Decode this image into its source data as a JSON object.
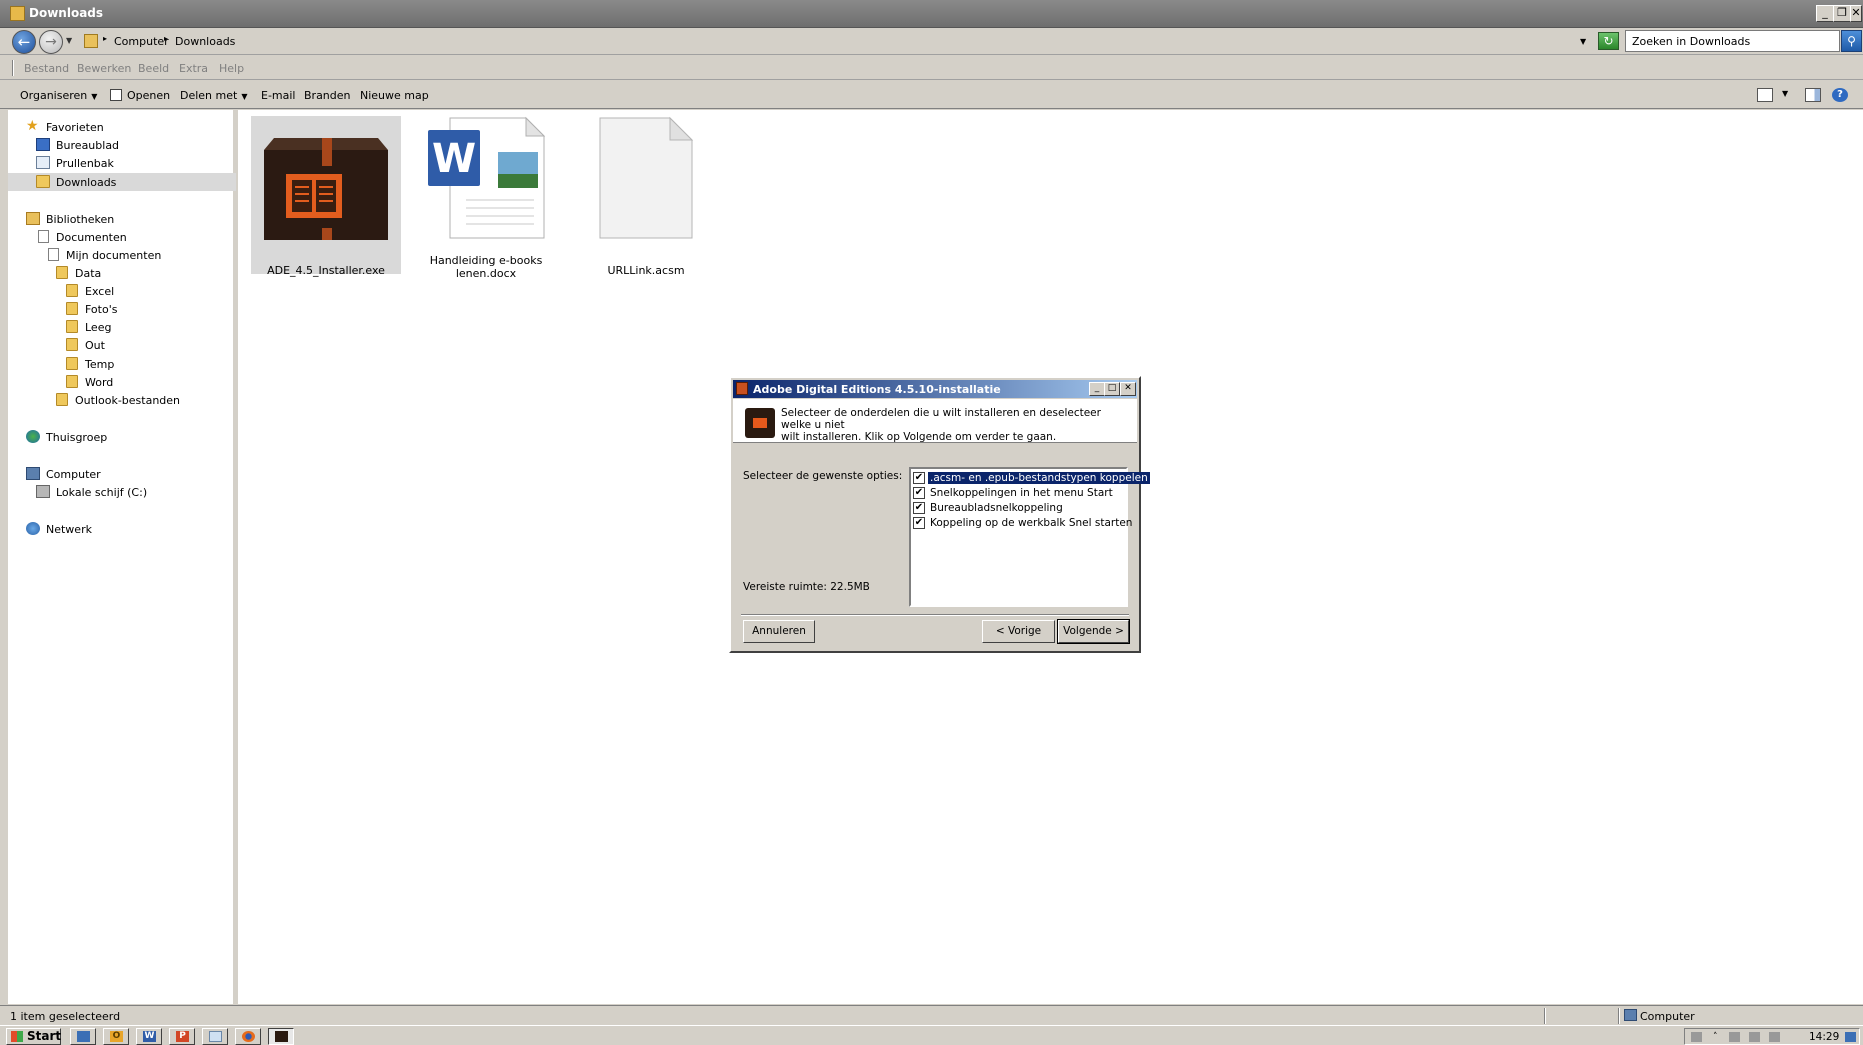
{
  "window": {
    "title": "Downloads",
    "minimize_glyph": "_",
    "restore_glyph": "❐",
    "close_glyph": "✕"
  },
  "address": {
    "crumbs": [
      "Computer",
      "Downloads"
    ],
    "search_placeholder": "Zoeken in Downloads"
  },
  "menu": {
    "items": [
      "Bestand",
      "Bewerken",
      "Beeld",
      "Extra",
      "Help"
    ]
  },
  "toolbar": {
    "organize": "Organiseren",
    "open": "Openen",
    "share": "Delen met",
    "email": "E-mail",
    "burn": "Branden",
    "new_folder": "Nieuwe map"
  },
  "nav": {
    "favorites": "Favorieten",
    "desktop": "Bureaublad",
    "recycle": "Prullenbak",
    "downloads": "Downloads",
    "libraries": "Bibliotheken",
    "documents": "Documenten",
    "my_documents": "Mijn documenten",
    "data": "Data",
    "excel": "Excel",
    "photos": "Foto's",
    "empty": "Leeg",
    "out": "Out",
    "temp": "Temp",
    "word": "Word",
    "outlook": "Outlook-bestanden",
    "homegroup": "Thuisgroep",
    "computer": "Computer",
    "local_disk": "Lokale schijf (C:)",
    "network": "Netwerk"
  },
  "files": [
    {
      "name": "ADE_4.5_Installer.exe",
      "icon": "installer-box-icon",
      "selected": true
    },
    {
      "name_line1": "Handleiding e-books",
      "name_line2": "lenen.docx",
      "icon": "word-document-icon"
    },
    {
      "name": "URLLink.acsm",
      "icon": "blank-file-icon"
    }
  ],
  "dialog": {
    "title": "Adobe Digital Editions 4.5.10-installatie",
    "intro_line1": "Selecteer de onderdelen die u wilt installeren en deselecteer welke u niet",
    "intro_line2": "wilt installeren. Klik op Volgende om verder te gaan.",
    "options_label": "Selecteer de gewenste opties:",
    "options": [
      {
        "label": ".acsm- en .epub-bestandstypen koppelen",
        "checked": true,
        "highlighted": true
      },
      {
        "label": "Snelkoppelingen in het menu Start",
        "checked": true
      },
      {
        "label": "Bureaubladsnelkoppeling",
        "checked": true
      },
      {
        "label": "Koppeling op de werkbalk Snel starten",
        "checked": true
      }
    ],
    "space_required": "Vereiste ruimte: 22.5MB",
    "cancel": "Annuleren",
    "back": "< Vorige",
    "next": "Volgende >"
  },
  "status": {
    "selection": "1 item geselecteerd",
    "location": "Computer"
  },
  "taskbar": {
    "start": "Start",
    "apps": [
      "show-desktop-icon",
      "outlook-icon",
      "word-icon",
      "powerpoint-icon",
      "notepad-icon",
      "firefox-icon",
      "adobe-installer-icon"
    ],
    "clock": "14:29"
  }
}
